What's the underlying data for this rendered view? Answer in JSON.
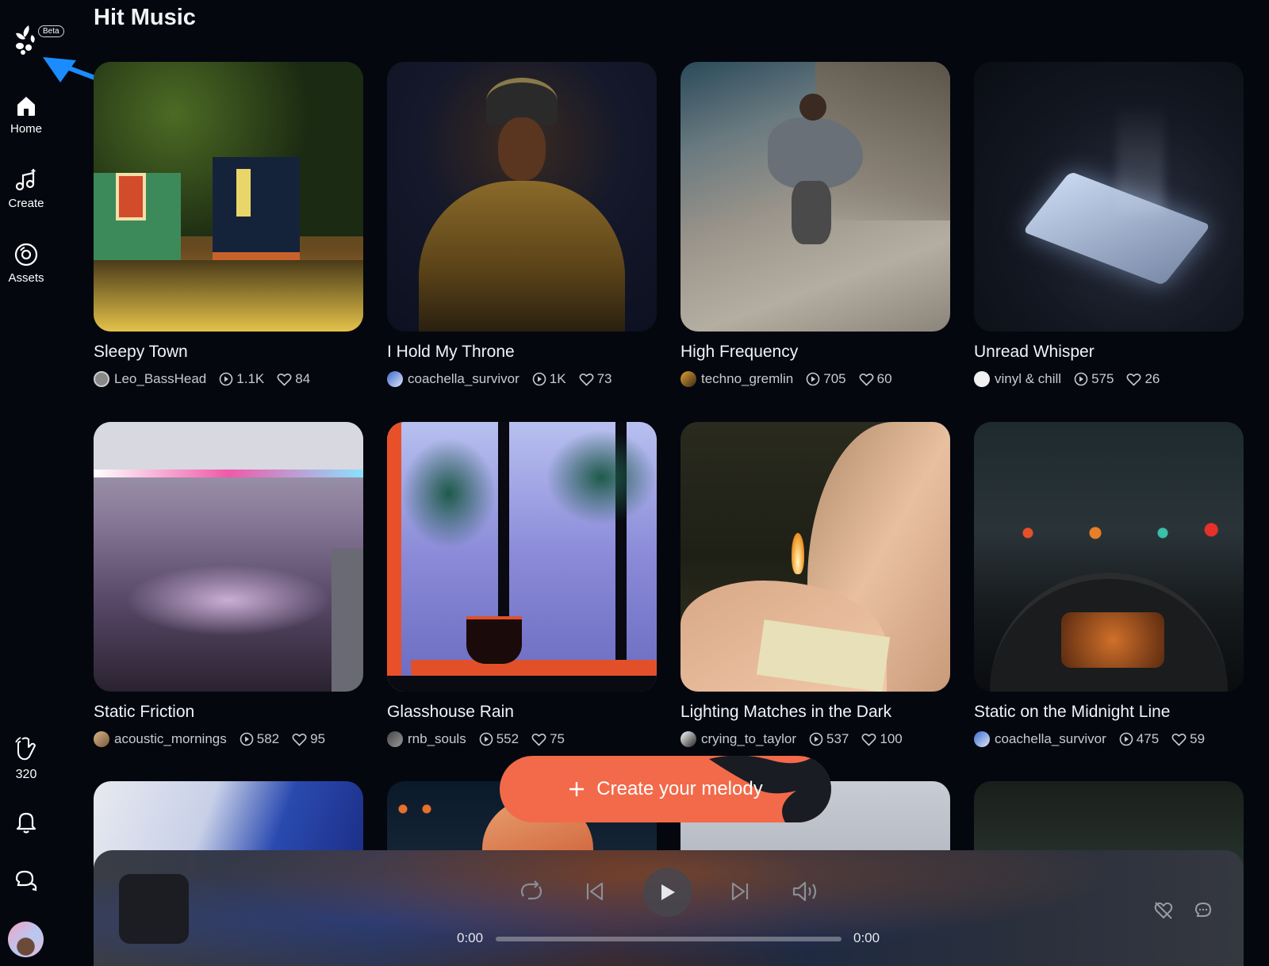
{
  "sidebar": {
    "beta_label": "Beta",
    "items": [
      {
        "label": "Home",
        "icon": "home-icon"
      },
      {
        "label": "Create",
        "icon": "music-note-plus-icon"
      },
      {
        "label": "Assets",
        "icon": "disc-icon"
      }
    ],
    "credits": "320"
  },
  "page": {
    "title": "Hit Music"
  },
  "cards": [
    {
      "title": "Sleepy Town",
      "author": "Leo_BassHead",
      "plays": "1.1K",
      "likes": "84"
    },
    {
      "title": "I Hold My Throne",
      "author": "coachella_survivor",
      "plays": "1K",
      "likes": "73"
    },
    {
      "title": "High Frequency",
      "author": "techno_gremlin",
      "plays": "705",
      "likes": "60"
    },
    {
      "title": "Unread Whisper",
      "author": "vinyl & chill",
      "plays": "575",
      "likes": "26"
    },
    {
      "title": "Static Friction",
      "author": "acoustic_mornings",
      "plays": "582",
      "likes": "95"
    },
    {
      "title": "Glasshouse Rain",
      "author": "rnb_souls",
      "plays": "552",
      "likes": "75"
    },
    {
      "title": "Lighting Matches in the Dark",
      "author": "crying_to_taylor",
      "plays": "537",
      "likes": "100"
    },
    {
      "title": "Static on the Midnight Line",
      "author": "coachella_survivor",
      "plays": "475",
      "likes": "59"
    }
  ],
  "create_button": {
    "label": "Create your melody"
  },
  "player": {
    "current_time": "0:00",
    "total_time": "0:00"
  },
  "colors": {
    "accent": "#f26a4a",
    "background": "#05070f",
    "annotation_arrow": "#1a8cff"
  }
}
